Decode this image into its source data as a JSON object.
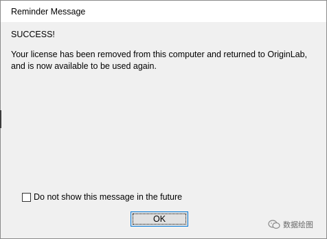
{
  "window": {
    "title": "Reminder Message"
  },
  "content": {
    "heading": "SUCCESS!",
    "message": "Your license has been removed from this computer and returned to OriginLab, and is now available to be used again."
  },
  "options": {
    "dont_show_label": "Do not show this message in the future",
    "dont_show_checked": false
  },
  "buttons": {
    "ok_label": "OK"
  },
  "watermark": {
    "text": "数据绘图"
  },
  "colors": {
    "dialog_bg": "#f0f0f0",
    "titlebar_bg": "#ffffff",
    "button_focus_border": "#0078d7"
  }
}
